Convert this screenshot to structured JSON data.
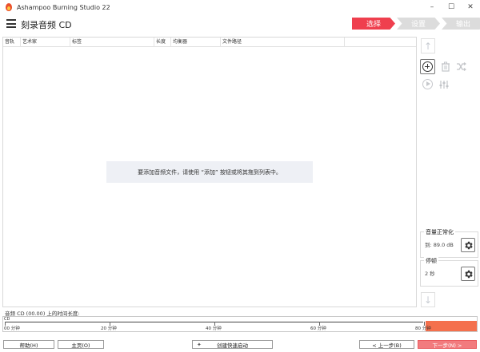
{
  "titlebar": {
    "title": "Ashampoo Burning Studio 22",
    "minimize": "–",
    "maximize": "☐",
    "close": "✕"
  },
  "header": {
    "title": "刻录音频 CD",
    "steps": [
      "选择",
      "设置",
      "输出"
    ],
    "active_step": "选择"
  },
  "table": {
    "columns": [
      "音轨",
      "艺术家",
      "标签",
      "长度",
      "均衡器",
      "文件路径"
    ],
    "empty_hint": "要添加音频文件，请使用 “添加” 按钮或将其拖到列表中。"
  },
  "right_panel": {
    "normalize": {
      "title": "音量正常化",
      "value": "到: 89.0 dB"
    },
    "pause": {
      "title": "停顿",
      "value": "2 秒"
    }
  },
  "timeline": {
    "label": "音频 CD (00.00) 上的时间长度:",
    "cd_tag": "CD",
    "ticks": [
      "00 分钟",
      "20 分钟",
      "40 分钟",
      "60 分钟",
      "80 分钟"
    ]
  },
  "buttons": {
    "help": "帮助(H)",
    "home": "主页(O)",
    "shortcut": "创建快速启动",
    "back": "< 上一步(B)",
    "next": "下一步(N) >"
  },
  "colors": {
    "accent": "#ef3f4e",
    "timeline_overflow": "#f4704d"
  }
}
